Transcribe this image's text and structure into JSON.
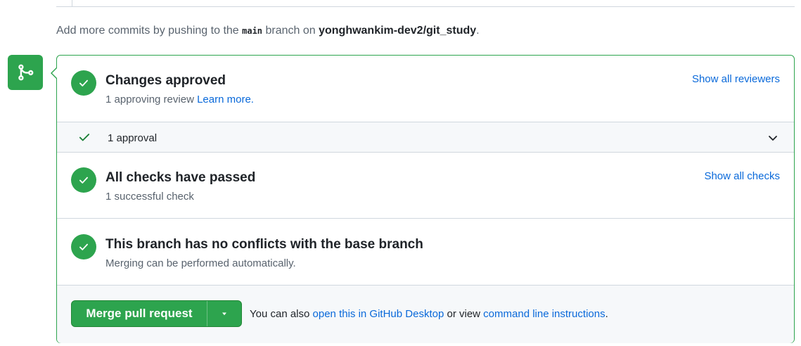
{
  "hint": {
    "prefix": "Add more commits by pushing to the ",
    "branch": "main",
    "middle": " branch on ",
    "repo": "yonghwankim-dev2/git_study",
    "suffix": "."
  },
  "approved": {
    "title": "Changes approved",
    "subtitle": "1 approving review ",
    "learn_more": "Learn more.",
    "show_reviewers": "Show all reviewers"
  },
  "approval_row": {
    "label": "1 approval"
  },
  "checks": {
    "title": "All checks have passed",
    "subtitle": "1 successful check",
    "show_checks": "Show all checks"
  },
  "conflicts": {
    "title": "This branch has no conflicts with the base branch",
    "subtitle": "Merging can be performed automatically."
  },
  "merge": {
    "button_label": "Merge pull request",
    "note_prefix": "You can also ",
    "desktop_link": "open this in GitHub Desktop",
    "note_middle": " or view ",
    "cli_link": "command line instructions",
    "note_suffix": "."
  },
  "colors": {
    "success": "#2da44e",
    "link": "#0969da",
    "muted": "#59636e",
    "border": "#d0d7de"
  },
  "icons": {
    "merge_status": "git-merge-icon",
    "check": "check-circle-icon",
    "approval": "check-icon",
    "expand": "chevron-down-icon",
    "dropdown": "triangle-down-icon"
  }
}
